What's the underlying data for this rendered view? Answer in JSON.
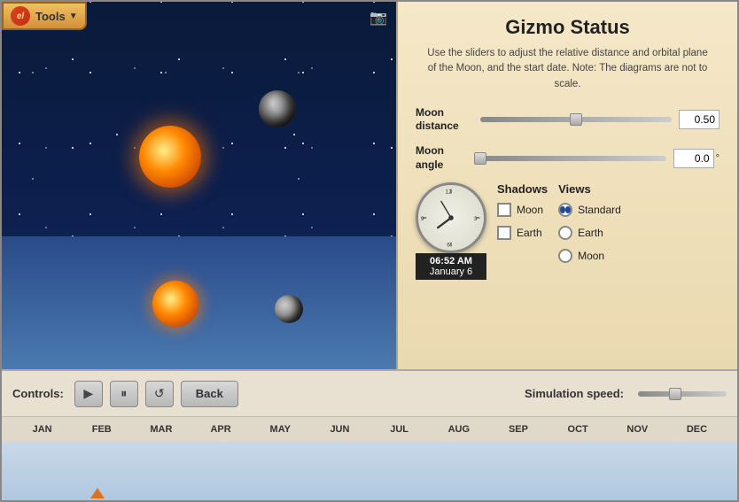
{
  "toolbar": {
    "logo_text": "el",
    "tools_label": "Tools"
  },
  "gizmo": {
    "title": "Gizmo Status",
    "description": "Use the sliders to adjust the relative distance and orbital plane of the Moon, and the start date. Note: The diagrams are not to scale.",
    "moon_distance_label": "Moon distance",
    "moon_angle_label": "Moon angle",
    "moon_distance_value": "0.50",
    "moon_angle_value": "0.0",
    "moon_angle_unit": "°"
  },
  "clock": {
    "time": "06:52 AM",
    "date": "January 6"
  },
  "shadows": {
    "header": "Shadows",
    "moon_label": "Moon",
    "earth_label": "Earth"
  },
  "views": {
    "header": "Views",
    "standard_label": "Standard",
    "earth_label": "Earth",
    "moon_label": "Moon",
    "selected": "Standard"
  },
  "controls": {
    "label": "Controls:",
    "back_label": "Back",
    "speed_label": "Simulation speed:"
  },
  "months": [
    "JAN",
    "FEB",
    "MAR",
    "APR",
    "MAY",
    "JUN",
    "JUL",
    "AUG",
    "SEP",
    "OCT",
    "NOV",
    "DEC"
  ]
}
